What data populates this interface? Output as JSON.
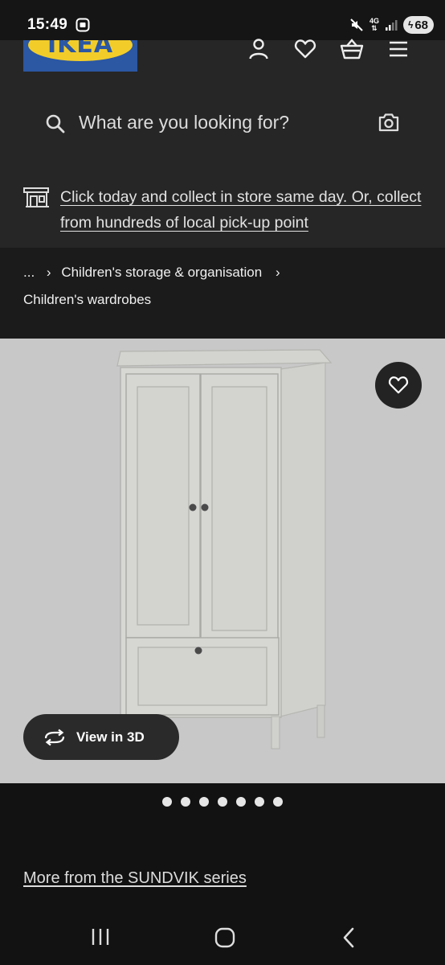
{
  "status_bar": {
    "time": "15:49",
    "network": "4G",
    "battery": "68",
    "icons": [
      "screenshot-icon",
      "mute-icon",
      "signal-icon",
      "battery-icon"
    ]
  },
  "header": {
    "logo_text": "IKEA",
    "icons": [
      "user-icon",
      "heart-icon",
      "basket-icon",
      "menu-icon"
    ]
  },
  "search": {
    "placeholder": "What are you looking for?"
  },
  "promo": {
    "text": "Click today and collect in store same day. Or, collect from hundreds of local pick-up point"
  },
  "breadcrumb": {
    "ellipsis": "...",
    "parent": "Children's storage & organisation",
    "current": "Children's wardrobes"
  },
  "product_media": {
    "view_3d_label": "View in 3D",
    "image_count": 7,
    "active_image": 1
  },
  "series_link": "More from the SUNDVIK series",
  "colors": {
    "background": "#121212",
    "header": "#262626",
    "image_background": "#c8c8c8",
    "logo_blue": "#2b57a3",
    "logo_yellow": "#f2cd2a"
  }
}
